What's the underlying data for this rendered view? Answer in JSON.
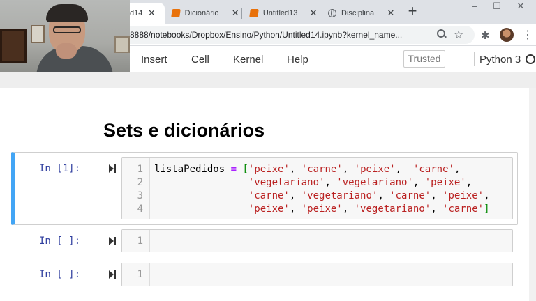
{
  "browser": {
    "tabs": [
      {
        "title": "d14",
        "icon": "jupyter",
        "active": true
      },
      {
        "title": "Dicionário",
        "icon": "book-icon",
        "active": false
      },
      {
        "title": "Untitled13",
        "icon": "book-icon",
        "active": false
      },
      {
        "title": "Disciplina",
        "icon": "globe-icon",
        "active": false
      }
    ],
    "new_tab": "+",
    "close_glyph": "✕",
    "window_controls": {
      "minimize": "–",
      "maximize": "☐",
      "close": "✕"
    },
    "url": "8888/notebooks/Dropbox/Ensino/Python/Untitled14.ipynb?kernel_name...",
    "zoom_icon": "zoom-icon",
    "star_glyph": "☆",
    "extensions_glyph": "✱",
    "menu_glyph": "⋮"
  },
  "jupyter": {
    "menu": [
      "Insert",
      "Cell",
      "Kernel",
      "Help"
    ],
    "trusted": "Trusted",
    "kernel": "Python 3"
  },
  "notebook": {
    "heading": "Sets e dicionários",
    "cells": [
      {
        "prompt": "In [1]:",
        "line_numbers": [
          "1",
          "2",
          "3",
          "4"
        ],
        "code_lines": [
          "listaPedidos = ['peixe', 'carne', 'peixe',  'carne',",
          "                'vegetariano', 'vegetariano', 'peixe',",
          "                'carne', 'vegetariano', 'carne', 'peixe',",
          "                'peixe', 'peixe', 'vegetariano', 'carne']"
        ]
      },
      {
        "prompt": "In [ ]:",
        "line_numbers": [
          "1"
        ],
        "code_lines": [
          ""
        ]
      },
      {
        "prompt": "In [ ]:",
        "line_numbers": [
          "1"
        ],
        "code_lines": [
          ""
        ]
      }
    ]
  },
  "colors": {
    "selected_cell_bar": "#42a5f5",
    "prompt": "#303f9f",
    "string": "#ba2121",
    "operator": "#aa22ff",
    "bracket": "#008800"
  }
}
